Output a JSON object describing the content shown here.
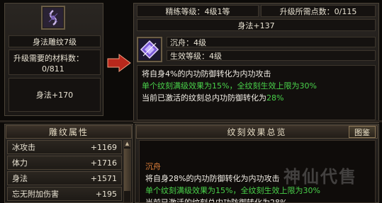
{
  "colors": {
    "accent_red": "#c4301f",
    "green_text": "#49d24a",
    "orange_text": "#e0803a"
  },
  "left_panel": {
    "icon": "skill-rune-icon",
    "title": "身法雕纹7级",
    "materials_label": "升级需要的材料数：",
    "materials_value": "0/811",
    "bonus": "身法+170"
  },
  "header": {
    "refine_level": "精练等级：4级1等",
    "points_needed": "升级所需点数：0/115",
    "stat_bonus": "身法+137"
  },
  "rune": {
    "icon": "rune-crystal-icon",
    "name": "沉舟：4级",
    "effect_level": "生效等级：4级"
  },
  "description": {
    "line1": "将自身4%的内功防御转化为内功攻击",
    "line2": "单个纹刻满级效果为15%，全纹刻生效上限为30%",
    "line3_prefix": "当前已激活的纹刻总内功防御转化为",
    "line3_value": "28%"
  },
  "arrow_icon": "right-arrow-icon",
  "attributes": {
    "header": "雕纹属性",
    "items": [
      {
        "name": "冰攻击",
        "value": "+1169"
      },
      {
        "name": "体力",
        "value": "+1716"
      },
      {
        "name": "身法",
        "value": "+1571"
      },
      {
        "name": "忘无附加伤害",
        "value": "+195"
      }
    ]
  },
  "effects": {
    "header": "纹刻效果总览",
    "atlas_button": "图鉴",
    "entry_name": "沉舟",
    "line1": "将自身28%的内功防御转化为内功攻击",
    "line2": "单个纹刻满级效果为15%，全纹刻生效上限为30%",
    "line3": "当前已激活的纹刻总内功防御转化为28%"
  },
  "watermark": "神仙代售"
}
